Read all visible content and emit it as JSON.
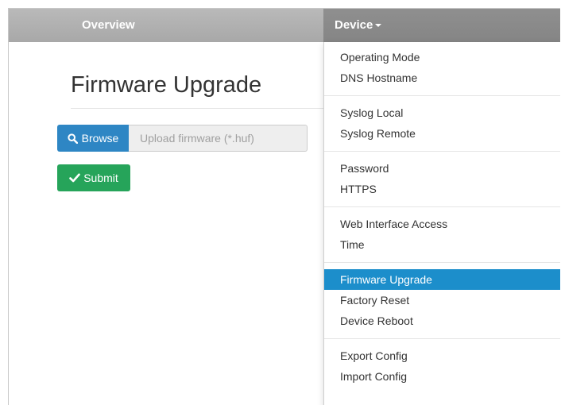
{
  "navbar": {
    "overview_label": "Overview",
    "device_label": "Device"
  },
  "page": {
    "title": "Firmware Upgrade"
  },
  "upload": {
    "browse_label": "Browse",
    "placeholder": "Upload firmware (*.huf)",
    "value": ""
  },
  "submit": {
    "label": "Submit"
  },
  "device_menu": {
    "groups": [
      [
        "Operating Mode",
        "DNS Hostname"
      ],
      [
        "Syslog Local",
        "Syslog Remote"
      ],
      [
        "Password",
        "HTTPS"
      ],
      [
        "Web Interface Access",
        "Time"
      ],
      [
        "Firmware Upgrade",
        "Factory Reset",
        "Device Reboot"
      ],
      [
        "Export Config",
        "Import Config"
      ]
    ],
    "active_item": "Firmware Upgrade"
  },
  "colors": {
    "navbar": "#aeaeae",
    "navbar_active": "#8a8a8a",
    "primary": "#2e86c4",
    "success": "#26a45a",
    "menu_active": "#1c8ecb"
  },
  "icons": {
    "browse": "search-icon",
    "submit": "checkmark-icon",
    "device": "caret-down-icon"
  }
}
